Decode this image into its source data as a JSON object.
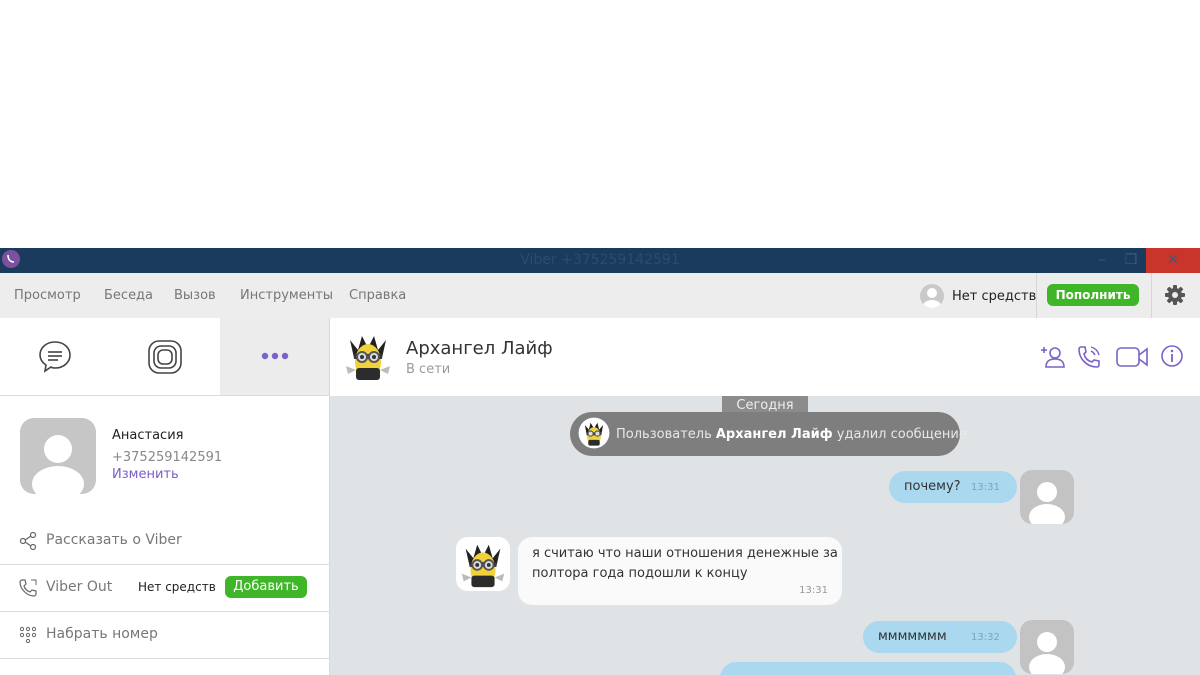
{
  "window": {
    "title": "Viber +375259142591",
    "minimize": "–",
    "maximize": "❐",
    "close": "✕"
  },
  "menu": [
    "Просмотр",
    "Беседа",
    "Вызов",
    "Инструменты",
    "Справка"
  ],
  "account": {
    "balance_text": "Нет средств",
    "topup_label": "Пополнить"
  },
  "sidebar": {
    "tabs": [
      "chats-icon",
      "contacts-icon",
      "more-icon"
    ],
    "profile": {
      "name": "Анастасия",
      "phone": "+375259142591",
      "edit_label": "Изменить"
    },
    "items": {
      "share": "Рассказать о Viber",
      "viber_out": "Viber Out",
      "viber_out_balance": "Нет средств",
      "add_label": "Добавить",
      "dial": "Набрать номер"
    }
  },
  "chat": {
    "contact_name": "Архангел Лайф",
    "contact_status": "В сети",
    "date_chip": "Сегодня",
    "notice": {
      "prefix": "Пользователь ",
      "name": "Архангел Лайф",
      "suffix": " удалил сообщение"
    },
    "messages": [
      {
        "dir": "out",
        "text": "почему?",
        "time": "13:31"
      },
      {
        "dir": "in",
        "line1": "я считаю что наши отношения денежные за",
        "line2": "полтора года подошли к концу",
        "time": "13:31"
      },
      {
        "dir": "out",
        "text": "ммммммм",
        "time": "13:32"
      }
    ]
  },
  "colors": {
    "accent": "#7b519d",
    "green": "#3fb528",
    "titlebar": "#1a3a5e",
    "bubble_out": "#a9d8ef"
  }
}
